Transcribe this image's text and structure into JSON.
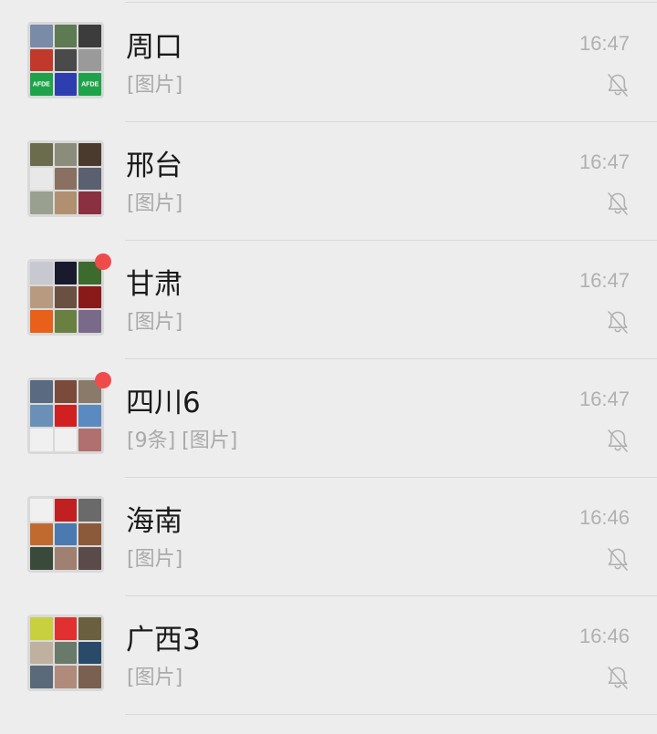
{
  "chats": [
    {
      "name": "周口",
      "preview": "[图片]",
      "time": "16:47",
      "unread": false,
      "muted": true,
      "avatar_tiles": [
        {
          "color": "#7a8ba8",
          "text": ""
        },
        {
          "color": "#5d7a52",
          "text": ""
        },
        {
          "color": "#3c3c3c",
          "text": ""
        },
        {
          "color": "#c0392b",
          "text": ""
        },
        {
          "color": "#4a4a4a",
          "text": ""
        },
        {
          "color": "#9a9a9a",
          "text": ""
        },
        {
          "color": "#1fa34a",
          "text": "AFDE"
        },
        {
          "color": "#2d3fb0",
          "text": ""
        },
        {
          "color": "#1fa34a",
          "text": "AFDE"
        }
      ]
    },
    {
      "name": "邢台",
      "preview": "[图片]",
      "time": "16:47",
      "unread": false,
      "muted": true,
      "avatar_tiles": [
        {
          "color": "#6b6b4e",
          "text": ""
        },
        {
          "color": "#8c8c7a",
          "text": ""
        },
        {
          "color": "#4a3a2e",
          "text": ""
        },
        {
          "color": "#e8e8e8",
          "text": ""
        },
        {
          "color": "#8a7060",
          "text": ""
        },
        {
          "color": "#5a6070",
          "text": ""
        },
        {
          "color": "#9aa090",
          "text": ""
        },
        {
          "color": "#b09070",
          "text": ""
        },
        {
          "color": "#8a3040",
          "text": ""
        }
      ]
    },
    {
      "name": "甘肃",
      "preview": "[图片]",
      "time": "16:47",
      "unread": true,
      "muted": true,
      "avatar_tiles": [
        {
          "color": "#c8c8d0",
          "text": ""
        },
        {
          "color": "#1a1a2e",
          "text": ""
        },
        {
          "color": "#3d6b2e",
          "text": ""
        },
        {
          "color": "#b89a80",
          "text": ""
        },
        {
          "color": "#6a5040",
          "text": ""
        },
        {
          "color": "#8a1a1a",
          "text": ""
        },
        {
          "color": "#e8601a",
          "text": ""
        },
        {
          "color": "#6a8040",
          "text": ""
        },
        {
          "color": "#7a6a8a",
          "text": ""
        }
      ]
    },
    {
      "name": "四川6",
      "preview": "[9条] [图片]",
      "time": "16:47",
      "unread": true,
      "muted": true,
      "avatar_tiles": [
        {
          "color": "#5a6a80",
          "text": ""
        },
        {
          "color": "#7a4a3a",
          "text": ""
        },
        {
          "color": "#8a7a6a",
          "text": ""
        },
        {
          "color": "#6a90b8",
          "text": ""
        },
        {
          "color": "#d02020",
          "text": ""
        },
        {
          "color": "#5a8ac0",
          "text": ""
        },
        {
          "color": "#f0f0f0",
          "text": ""
        },
        {
          "color": "#f0f0f0",
          "text": ""
        },
        {
          "color": "#b07070",
          "text": ""
        }
      ]
    },
    {
      "name": "海南",
      "preview": "[图片]",
      "time": "16:46",
      "unread": false,
      "muted": true,
      "avatar_tiles": [
        {
          "color": "#f0f0f0",
          "text": ""
        },
        {
          "color": "#c02020",
          "text": ""
        },
        {
          "color": "#6a6a6a",
          "text": ""
        },
        {
          "color": "#c06a30",
          "text": ""
        },
        {
          "color": "#4a7ab0",
          "text": ""
        },
        {
          "color": "#8a5a3a",
          "text": ""
        },
        {
          "color": "#3a4a3a",
          "text": ""
        },
        {
          "color": "#a08070",
          "text": ""
        },
        {
          "color": "#5a4a4a",
          "text": ""
        }
      ]
    },
    {
      "name": "广西3",
      "preview": "[图片]",
      "time": "16:46",
      "unread": false,
      "muted": true,
      "avatar_tiles": [
        {
          "color": "#c8d040",
          "text": ""
        },
        {
          "color": "#e03030",
          "text": ""
        },
        {
          "color": "#6a6040",
          "text": ""
        },
        {
          "color": "#c0b0a0",
          "text": ""
        },
        {
          "color": "#6a7a6a",
          "text": ""
        },
        {
          "color": "#2a4a6a",
          "text": ""
        },
        {
          "color": "#5a6a7a",
          "text": ""
        },
        {
          "color": "#b08a7a",
          "text": ""
        },
        {
          "color": "#7a6050",
          "text": ""
        }
      ]
    }
  ]
}
